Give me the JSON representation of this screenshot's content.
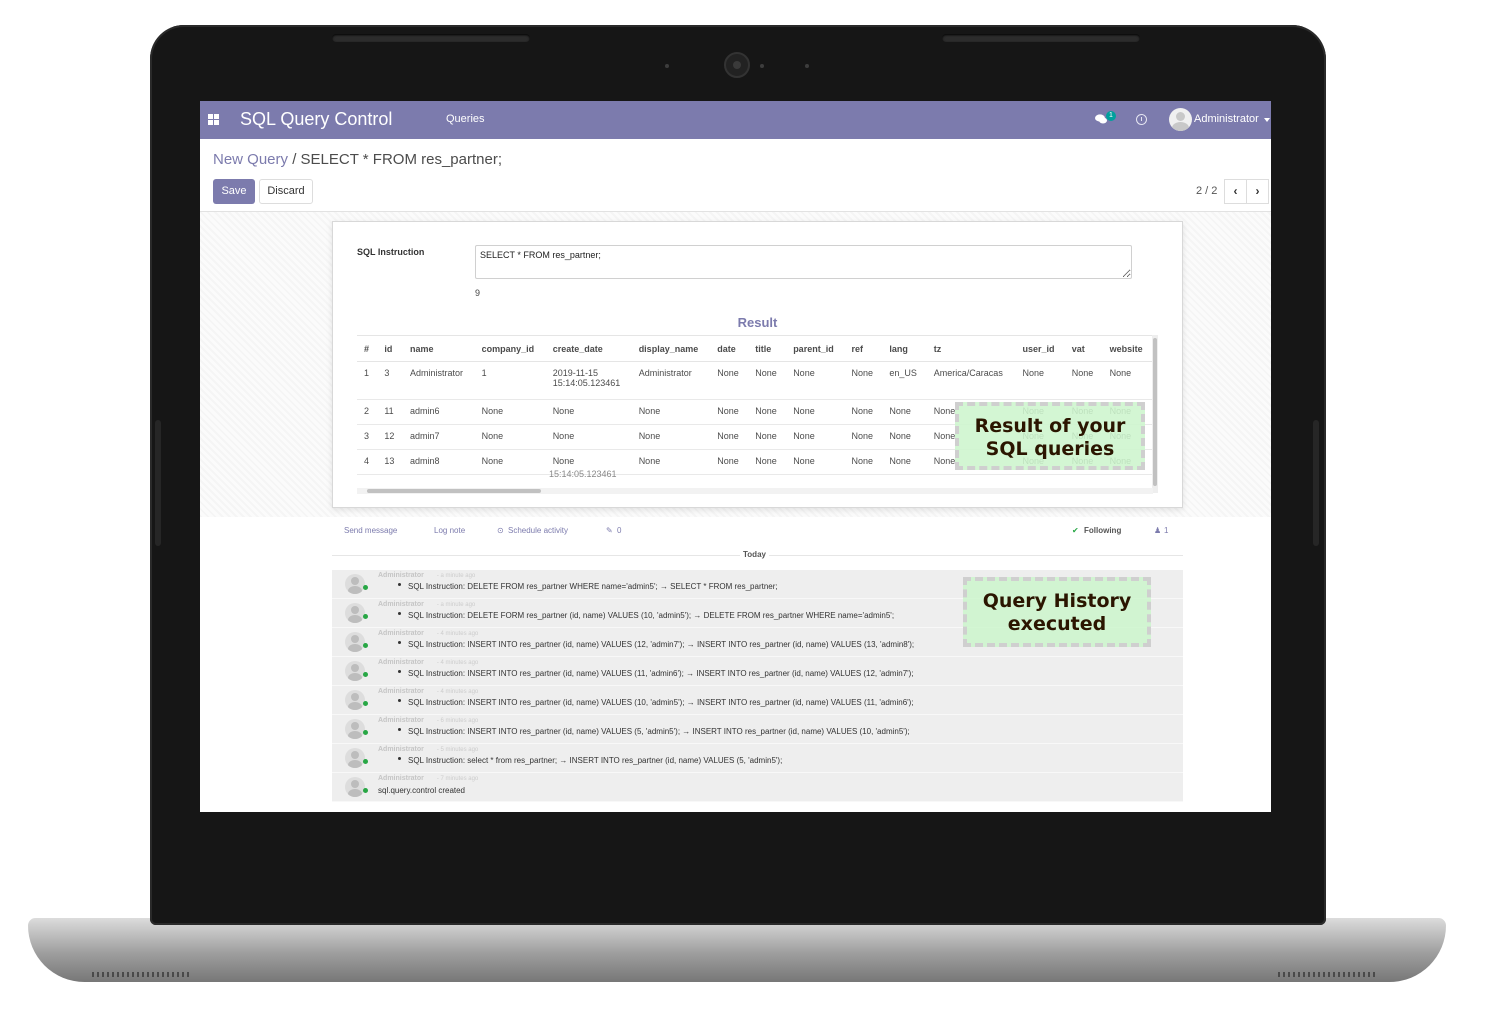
{
  "app": {
    "brand": "SQL Query Control",
    "menu_queries": "Queries",
    "chat_count": "1",
    "user_name": "Administrator"
  },
  "control_panel": {
    "breadcrumb_root": "New Query",
    "breadcrumb_sep": "/",
    "breadcrumb_current": "SELECT * FROM res_partner;",
    "save_label": "Save",
    "discard_label": "Discard",
    "pager_value": "2 / 2",
    "pager_prev": "‹",
    "pager_next": "›"
  },
  "form": {
    "sql_label": "SQL Instruction",
    "sql_value": "SELECT * FROM res_partner;",
    "row_count": "9",
    "result_title": "Result",
    "columns": [
      "#",
      "id",
      "name",
      "company_id",
      "create_date",
      "display_name",
      "date",
      "title",
      "parent_id",
      "ref",
      "lang",
      "tz",
      "user_id",
      "vat",
      "website"
    ],
    "rows": [
      [
        "1",
        "3",
        "Administrator",
        "1",
        "2019-11-15 15:14:05.123461",
        "Administrator",
        "None",
        "None",
        "None",
        "None",
        "en_US",
        "America/Caracas",
        "None",
        "None",
        "None"
      ],
      [
        "2",
        "11",
        "admin6",
        "None",
        "None",
        "None",
        "None",
        "None",
        "None",
        "None",
        "None",
        "None",
        "None",
        "None",
        "None"
      ],
      [
        "3",
        "12",
        "admin7",
        "None",
        "None",
        "None",
        "None",
        "None",
        "None",
        "None",
        "None",
        "None",
        "None",
        "None",
        "None"
      ],
      [
        "4",
        "13",
        "admin8",
        "None",
        "None",
        "None",
        "None",
        "None",
        "None",
        "None",
        "None",
        "None",
        "None",
        "None",
        "None"
      ]
    ],
    "clipped_text": "15:14:05.123461"
  },
  "callouts": {
    "result": "Result of your SQL queries",
    "history": "Query History executed"
  },
  "chatter": {
    "send_message": "Send message",
    "log_note": "Log note",
    "schedule_activity": "Schedule activity",
    "attachments": "0",
    "following": "Following",
    "followers": "1",
    "today": "Today",
    "messages": [
      {
        "author": "Administrator",
        "time": "- a minute ago",
        "body": "SQL Instruction: DELETE FROM res_partner WHERE name='admin5'; → SELECT * FROM res_partner;",
        "bullet": true
      },
      {
        "author": "Administrator",
        "time": "- a minute ago",
        "body": "SQL Instruction: DELETE FORM res_partner (id, name) VALUES (10, 'admin5'); → DELETE FROM res_partner WHERE name='admin5';",
        "bullet": true
      },
      {
        "author": "Administrator",
        "time": "- 4 minutes ago",
        "body": "SQL Instruction: INSERT INTO res_partner (id, name) VALUES (12, 'admin7'); → INSERT INTO res_partner (id, name) VALUES (13, 'admin8');",
        "bullet": true
      },
      {
        "author": "Administrator",
        "time": "- 4 minutes ago",
        "body": "SQL Instruction: INSERT INTO res_partner (id, name) VALUES (11, 'admin6'); → INSERT INTO res_partner (id, name) VALUES (12, 'admin7');",
        "bullet": true
      },
      {
        "author": "Administrator",
        "time": "- 4 minutes ago",
        "body": "SQL Instruction: INSERT INTO res_partner (id, name) VALUES (10, 'admin5'); → INSERT INTO res_partner (id, name) VALUES (11, 'admin6');",
        "bullet": true
      },
      {
        "author": "Administrator",
        "time": "- 6 minutes ago",
        "body": "SQL Instruction: INSERT INTO res_partner (id, name) VALUES (5, 'admin5'); → INSERT INTO res_partner (id, name) VALUES (10, 'admin5');",
        "bullet": true
      },
      {
        "author": "Administrator",
        "time": "- 5 minutes ago",
        "body": "SQL Instruction: select * from res_partner; → INSERT INTO res_partner (id, name) VALUES (5, 'admin5');",
        "bullet": true
      },
      {
        "author": "Administrator",
        "time": "- 7 minutes ago",
        "body": "sql.query.control created",
        "bullet": false
      }
    ]
  },
  "colors": {
    "brand": "#7c7bad",
    "online": "#28a745",
    "callout_bg": "#cdf5cd"
  },
  "icons": [
    "apps-icon",
    "chat-icon",
    "clock-icon",
    "avatar",
    "paperclip-icon",
    "check-icon",
    "follower-icon",
    "clock-small-icon"
  ]
}
